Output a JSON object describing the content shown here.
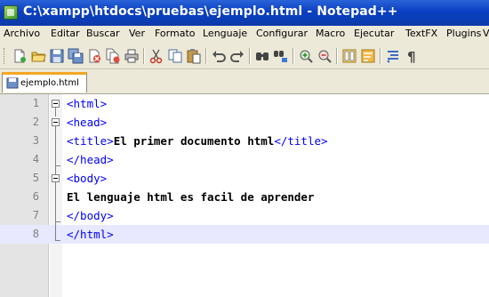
{
  "window": {
    "title": "C:\\xampp\\htdocs\\pruebas\\ejemplo.html - Notepad++"
  },
  "menu": [
    "Archivo",
    "Editar",
    "Buscar",
    "Ver",
    "Formato",
    "Lenguaje",
    "Configurar",
    "Macro",
    "Ejecutar",
    "TextFX",
    "Plugins",
    "V"
  ],
  "toolbar": {
    "buttons": [
      "new-file-icon",
      "open-file-icon",
      "save-icon",
      "save-all-icon",
      "close-icon",
      "close-all-icon",
      "print-icon",
      "cut-icon",
      "copy-icon",
      "paste-icon",
      "undo-icon",
      "redo-icon",
      "find-icon",
      "replace-icon",
      "zoom-in-icon",
      "zoom-out-icon",
      "sync-scroll-icon",
      "word-wrap-icon",
      "indent-guide-icon",
      "show-all-chars-icon"
    ]
  },
  "tabs": [
    {
      "label": "ejemplo.html",
      "active": true
    }
  ],
  "editor": {
    "current_line": 8,
    "lines": [
      {
        "number": "1",
        "parts": [
          {
            "t": "<html>",
            "c": "tag"
          }
        ]
      },
      {
        "number": "2",
        "parts": [
          {
            "t": "<head>",
            "c": "tag"
          }
        ]
      },
      {
        "number": "3",
        "parts": [
          {
            "t": "<title>",
            "c": "tag"
          },
          {
            "t": "El primer documento html",
            "c": "txt"
          },
          {
            "t": "</title>",
            "c": "tag"
          }
        ]
      },
      {
        "number": "4",
        "parts": [
          {
            "t": "</head>",
            "c": "tag"
          }
        ]
      },
      {
        "number": "5",
        "parts": [
          {
            "t": "<body>",
            "c": "tag"
          }
        ]
      },
      {
        "number": "6",
        "parts": [
          {
            "t": "El lenguaje html es facil de aprender",
            "c": "txt"
          }
        ]
      },
      {
        "number": "7",
        "parts": [
          {
            "t": "</body>",
            "c": "tag"
          }
        ]
      },
      {
        "number": "8",
        "parts": [
          {
            "t": "</html>",
            "c": "tag"
          }
        ]
      }
    ]
  },
  "colors": {
    "tag": "#0000ff",
    "text": "#000000",
    "title_bar": "#0a3fc2",
    "current_line": "#e8e8ff"
  }
}
